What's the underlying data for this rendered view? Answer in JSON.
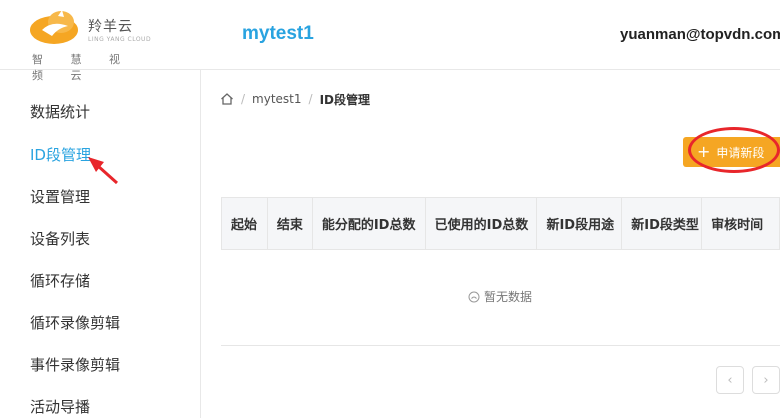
{
  "header": {
    "logo": {
      "name": "羚羊云",
      "en": "LING YANG CLOUD",
      "subtitle": "智 慧 视 频 云"
    },
    "project_title": "mytest1",
    "user_email": "yuanman@topvdn.com"
  },
  "sidebar": {
    "items": [
      {
        "label": "数据统计"
      },
      {
        "label": "ID段管理",
        "active": true
      },
      {
        "label": "设置管理"
      },
      {
        "label": "设备列表"
      },
      {
        "label": "循环存储"
      },
      {
        "label": "循环录像剪辑"
      },
      {
        "label": "事件录像剪辑"
      },
      {
        "label": "活动导播"
      }
    ]
  },
  "breadcrumb": {
    "project": "mytest1",
    "current": "ID段管理"
  },
  "toolbar": {
    "apply_label": "申请新段"
  },
  "table": {
    "columns": [
      "起始",
      "结束",
      "能分配的ID总数",
      "已使用的ID总数",
      "新ID段用途",
      "新ID段类型",
      "审核时间"
    ],
    "empty_text": "暂无数据"
  },
  "colors": {
    "accent": "#29a3e0",
    "button": "#f5a623",
    "annotation": "#e8262b"
  },
  "icons": {
    "home": "home-icon",
    "plus": "plus-icon",
    "empty": "empty-icon",
    "prev": "chevron-left-icon",
    "next": "chevron-right-icon"
  }
}
